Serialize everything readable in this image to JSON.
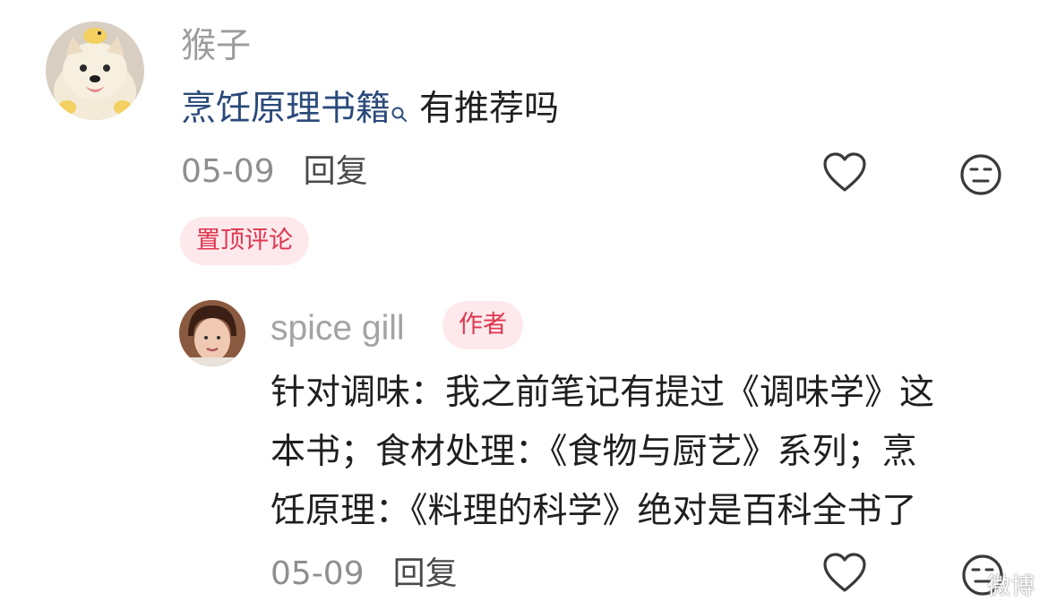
{
  "comment": {
    "username": "猴子",
    "text_link": "烹饪原理书籍",
    "text_rest": "有推荐吗",
    "date": "05-09",
    "reply_label": "回复",
    "pinned_label": "置顶评论"
  },
  "reply": {
    "username": "spice gill",
    "author_badge": "作者",
    "lines": [
      "针对调味：我之前笔记有提过《调味学》这",
      "本书；食材处理：《食物与厨艺》系列；烹",
      "饪原理：《料理的科学》绝对是百科全书了"
    ],
    "date": "05-09",
    "reply_label": "回复"
  },
  "watermark": "微博",
  "colors": {
    "accent_red": "#e0364f",
    "badge_bg": "#fde9ec",
    "link_blue": "#2b4a7a",
    "meta_gray": "#8f8f8f"
  },
  "icons": [
    "search-icon",
    "heart-icon",
    "dislike-face-icon"
  ]
}
